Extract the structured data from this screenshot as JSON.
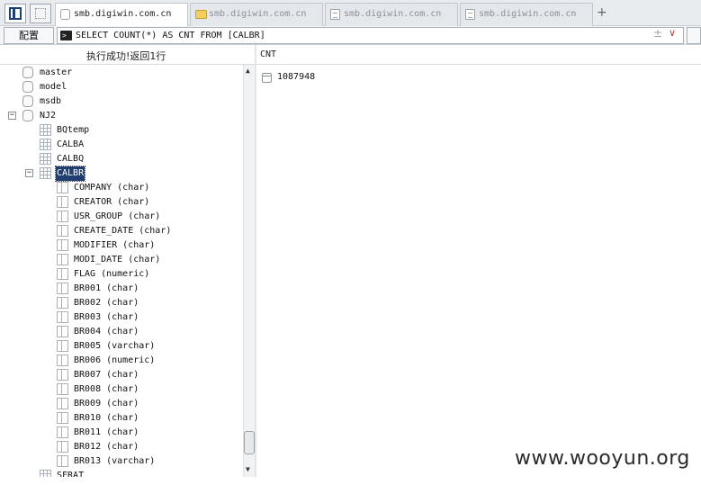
{
  "tabs": [
    {
      "label": "smb.digiwin.com.cn",
      "icon": "database-icon",
      "active": true
    },
    {
      "label": "smb.digiwin.com.cn",
      "icon": "folder-icon",
      "active": false
    },
    {
      "label": "smb.digiwin.com.cn",
      "icon": "document-icon",
      "active": false
    },
    {
      "label": "smb.digiwin.com.cn",
      "icon": "document-icon",
      "active": false
    }
  ],
  "tab_add_label": "+",
  "toolbar": {
    "config_label": "配置",
    "query": "SELECT COUNT(*) AS CNT FROM [CALBR]",
    "plus_symbol": "±",
    "chevron_symbol": "∨"
  },
  "status": {
    "message": "执行成功!返回1行"
  },
  "results": {
    "column": "CNT",
    "value": "1087948"
  },
  "tree": {
    "databases": [
      {
        "label": "master"
      },
      {
        "label": "model"
      },
      {
        "label": "msdb"
      },
      {
        "label": "NJ2",
        "expander": "−"
      }
    ],
    "tables": [
      {
        "label": "BQtemp"
      },
      {
        "label": "CALBA"
      },
      {
        "label": "CALBQ"
      },
      {
        "label": "CALBR",
        "expander": "−",
        "selected": true
      }
    ],
    "columns": [
      {
        "label": "COMPANY (char)"
      },
      {
        "label": "CREATOR (char)"
      },
      {
        "label": "USR_GROUP (char)"
      },
      {
        "label": "CREATE_DATE (char)"
      },
      {
        "label": "MODIFIER (char)"
      },
      {
        "label": "MODI_DATE (char)"
      },
      {
        "label": "FLAG (numeric)"
      },
      {
        "label": "BR001 (char)"
      },
      {
        "label": "BR002 (char)"
      },
      {
        "label": "BR003 (char)"
      },
      {
        "label": "BR004 (char)"
      },
      {
        "label": "BR005 (varchar)"
      },
      {
        "label": "BR006 (numeric)"
      },
      {
        "label": "BR007 (char)"
      },
      {
        "label": "BR008 (char)"
      },
      {
        "label": "BR009 (char)"
      },
      {
        "label": "BR010 (char)"
      },
      {
        "label": "BR011 (char)"
      },
      {
        "label": "BR012 (char)"
      },
      {
        "label": "BR013 (varchar)"
      }
    ],
    "next_table": {
      "label": "SFRAT"
    }
  },
  "watermark": "www.wooyun.org",
  "colors": {
    "selection": "#1f3f73",
    "accent": "#1d3f73"
  }
}
